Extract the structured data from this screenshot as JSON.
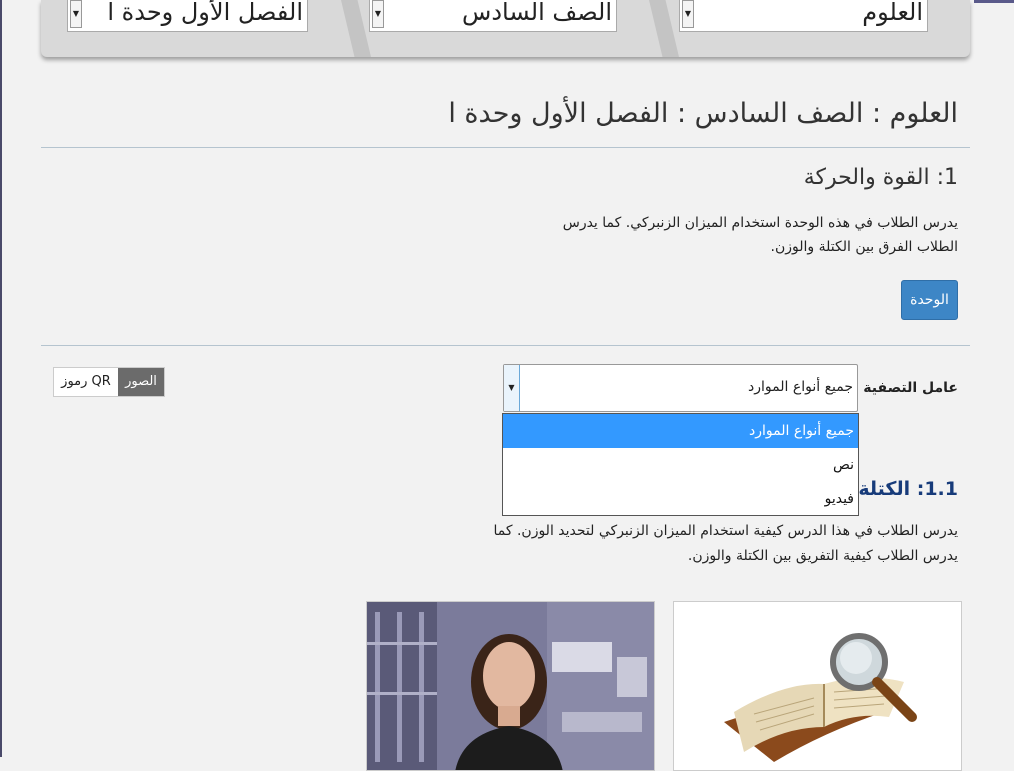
{
  "breadcrumb": {
    "subject": "العلوم",
    "grade": "الصف السادس",
    "unit": "الفصل الأول وحدة ا"
  },
  "page_title": "العلوم : الصف السادس : الفصل الأول وحدة ا",
  "unit": {
    "title": "1: القوة والحركة",
    "description": "يدرس الطلاب في هذه الوحدة استخدام الميزان الزنبركي. كما يدرس الطلاب الفرق بين الكتلة والوزن.",
    "button_label": "الوحدة"
  },
  "filter": {
    "label": "عامل التصفية",
    "selected": "جميع أنواع الموارد",
    "options": [
      "جميع أنواع الموارد",
      "نص",
      "فيديو"
    ]
  },
  "view_toggle": {
    "images_label": "الصور",
    "qr_label": "رموز QR"
  },
  "lesson": {
    "title": "1.1: الكتلة والوزن",
    "description": "يدرس الطلاب في هذا الدرس كيفية استخدام الميزان الزنبركي لتحديد الوزن. كما يدرس الطلاب كيفية التفريق بين الكتلة والوزن."
  },
  "colors": {
    "primary_button": "#3d86c6",
    "lesson_title": "#173b7a",
    "selected_option": "#3399ff"
  }
}
